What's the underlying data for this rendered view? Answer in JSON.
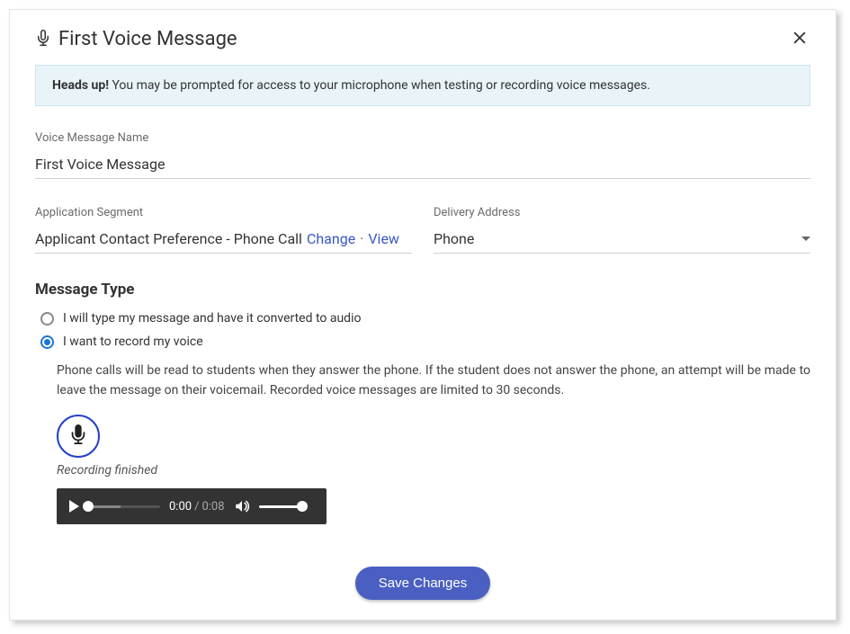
{
  "header": {
    "title": "First Voice Message"
  },
  "alert": {
    "prefix": "Heads up!",
    "text": " You may be prompted for access to your microphone when testing or recording voice messages."
  },
  "voice_name": {
    "label": "Voice Message Name",
    "value": "First Voice Message"
  },
  "segment": {
    "label": "Application Segment",
    "value": "Applicant Contact Preference - Phone Call",
    "change": "Change",
    "separator": "·",
    "view": "View"
  },
  "delivery": {
    "label": "Delivery Address",
    "value": "Phone"
  },
  "message_type": {
    "heading": "Message Type",
    "options": [
      "I will type my message and have it converted to audio",
      "I want to record my voice"
    ],
    "selected_index": 1,
    "helper": "Phone calls will be read to students when they answer the phone. If the student does not answer the phone, an attempt will be made to leave the message on their voicemail. Recorded voice messages are limited to 30 seconds."
  },
  "recording": {
    "status": "Recording finished",
    "current": "0:00",
    "slash": "/",
    "total": "0:08"
  },
  "footer": {
    "save": "Save Changes"
  }
}
